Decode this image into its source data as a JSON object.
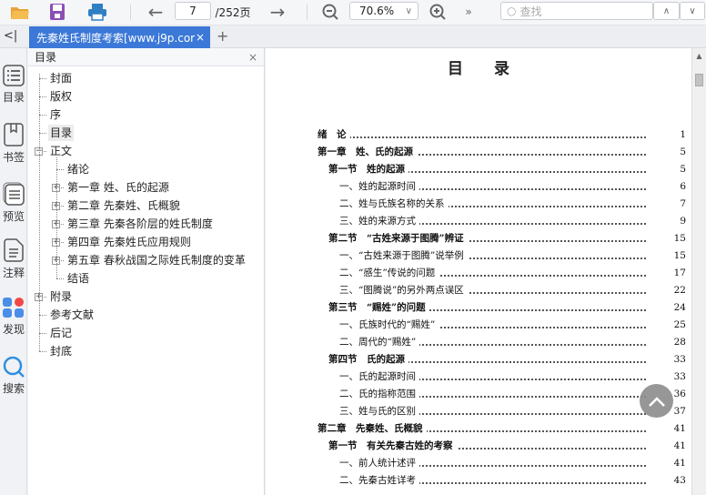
{
  "toolbar": {
    "page_current": "7",
    "page_total": "/252页",
    "zoom": "70.6%",
    "more": "»",
    "search_placeholder": "查找"
  },
  "tabs": {
    "collapse": "<|",
    "active": "先秦姓氏制度考索[www.j9p.cor",
    "close": "×",
    "add": "+"
  },
  "rail": [
    {
      "label": "目录"
    },
    {
      "label": "书签"
    },
    {
      "label": "预览"
    },
    {
      "label": "注释"
    },
    {
      "label": "发现"
    },
    {
      "label": "搜索"
    }
  ],
  "panel": {
    "title": "目录",
    "close": "×",
    "nodes": [
      {
        "label": "封面",
        "level": 0
      },
      {
        "label": "版权",
        "level": 0
      },
      {
        "label": "序",
        "level": 0
      },
      {
        "label": "目录",
        "level": 0,
        "selected": true
      },
      {
        "label": "正文",
        "level": 0,
        "expander": "−"
      },
      {
        "label": "绪论",
        "level": 1
      },
      {
        "label": "第一章 姓、氏的起源",
        "level": 1,
        "expander": "+"
      },
      {
        "label": "第二章 先秦姓、氏概貌",
        "level": 1,
        "expander": "+"
      },
      {
        "label": "第三章 先秦各阶层的姓氏制度",
        "level": 1,
        "expander": "+"
      },
      {
        "label": "第四章 先秦姓氏应用规则",
        "level": 1,
        "expander": "+"
      },
      {
        "label": "第五章 春秋战国之际姓氏制度的变革",
        "level": 1,
        "expander": "+"
      },
      {
        "label": "结语",
        "level": 1
      },
      {
        "label": "附录",
        "level": 0,
        "expander": "+"
      },
      {
        "label": "参考文献",
        "level": 0
      },
      {
        "label": "后记",
        "level": 0
      },
      {
        "label": "封底",
        "level": 0
      }
    ]
  },
  "page": {
    "title": "目　　录",
    "entries": [
      {
        "text": "绪　论",
        "page": "1",
        "level": 0
      },
      {
        "text": "第一章　姓、氏的起源",
        "page": "5",
        "level": 0
      },
      {
        "text": "第一节　姓的起源",
        "page": "5",
        "level": 1
      },
      {
        "text": "一、姓的起源时间",
        "page": "6",
        "level": 2
      },
      {
        "text": "二、姓与氏族名称的关系",
        "page": "7",
        "level": 2
      },
      {
        "text": "三、姓的来源方式",
        "page": "9",
        "level": 2
      },
      {
        "text": "第二节　“古姓来源于图腾”辨证",
        "page": "15",
        "level": 1
      },
      {
        "text": "一、“古姓来源于图腾”说举例",
        "page": "15",
        "level": 2
      },
      {
        "text": "二、“感生”传说的问题",
        "page": "17",
        "level": 2
      },
      {
        "text": "三、“图腾说”的另外两点误区",
        "page": "22",
        "level": 2
      },
      {
        "text": "第三节　“赐姓”的问题",
        "page": "24",
        "level": 1
      },
      {
        "text": "一、氏族时代的“赐姓”",
        "page": "25",
        "level": 2
      },
      {
        "text": "二、周代的“赐姓”",
        "page": "28",
        "level": 2
      },
      {
        "text": "第四节　氏的起源",
        "page": "33",
        "level": 1
      },
      {
        "text": "一、氏的起源时间",
        "page": "33",
        "level": 2
      },
      {
        "text": "二、氏的指称范围",
        "page": "36",
        "level": 2
      },
      {
        "text": "三、姓与氏的区别",
        "page": "37",
        "level": 2
      },
      {
        "text": "第二章　先秦姓、氏概貌",
        "page": "41",
        "level": 0
      },
      {
        "text": "第一节　有关先秦古姓的考察",
        "page": "41",
        "level": 1
      },
      {
        "text": "一、前人统计述评",
        "page": "41",
        "level": 2
      },
      {
        "text": "二、先秦古姓详考",
        "page": "43",
        "level": 2
      }
    ]
  }
}
